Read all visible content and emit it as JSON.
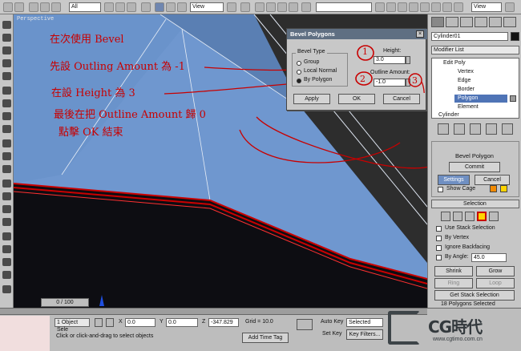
{
  "toolbar": {
    "dropdowns": [
      "All",
      "View",
      "View"
    ],
    "colors": {
      "accent_red": "#c80000"
    }
  },
  "viewport": {
    "label": "Perspective",
    "timeline": "0 / 100"
  },
  "annotations": [
    "在次使用 Bevel",
    "先設 Outling Amount 為 -1",
    "在設 Height 為 3",
    "最後在把 Outline Amount 歸 0",
    "點擊 OK 結束"
  ],
  "markers": [
    "1",
    "2",
    "3"
  ],
  "dialog": {
    "title": "Bevel Polygons",
    "close_icon": "close-icon",
    "group_label": "Bevel Type",
    "options": [
      "Group",
      "Local Normal",
      "By Polygon"
    ],
    "height_label": "Height:",
    "height_value": "3.0",
    "outline_label": "Outline Amount:",
    "outline_value": "-1.0",
    "buttons": {
      "apply": "Apply",
      "ok": "OK",
      "cancel": "Cancel"
    }
  },
  "command_panel": {
    "object_name": "Cylinder01",
    "modifier_list": "Modifier List",
    "stack": [
      "Edit Poly",
      "Vertex",
      "Edge",
      "Border",
      "Polygon",
      "Element",
      "Cylinder"
    ],
    "bevel_polygon": "Bevel Polygon",
    "commit": "Commit",
    "settings": "Settings",
    "cancel": "Cancel",
    "show_cage": "Show Cage",
    "selection": "Selection",
    "use_stack": "Use Stack Selection",
    "by_vertex": "By Vertex",
    "ignore_backfacing": "Ignore Backfacing",
    "by_angle": "By Angle:",
    "angle_value": "45.0",
    "shrink": "Shrink",
    "grow": "Grow",
    "ring": "Ring",
    "loop": "Loop",
    "get_stack": "Get Stack Selection",
    "selected_count": "18 Polygons Selected"
  },
  "status": {
    "selection": "1 Object Sele",
    "x_label": "X",
    "x_value": "0.0",
    "y_label": "Y",
    "y_value": "0.0",
    "z_label": "Z",
    "z_value": "-347.829",
    "grid": "Grid = 10.0",
    "auto_key": "Auto Key",
    "selected": "Selected",
    "set_key": "Set Key",
    "key_filters": "Key Filters...",
    "prompt": "Click or click-and-drag to select objects",
    "add_time_tag": "Add Time Tag"
  },
  "watermark": {
    "logo": "CG時代",
    "url": "www.cgtimo.com.cn"
  }
}
